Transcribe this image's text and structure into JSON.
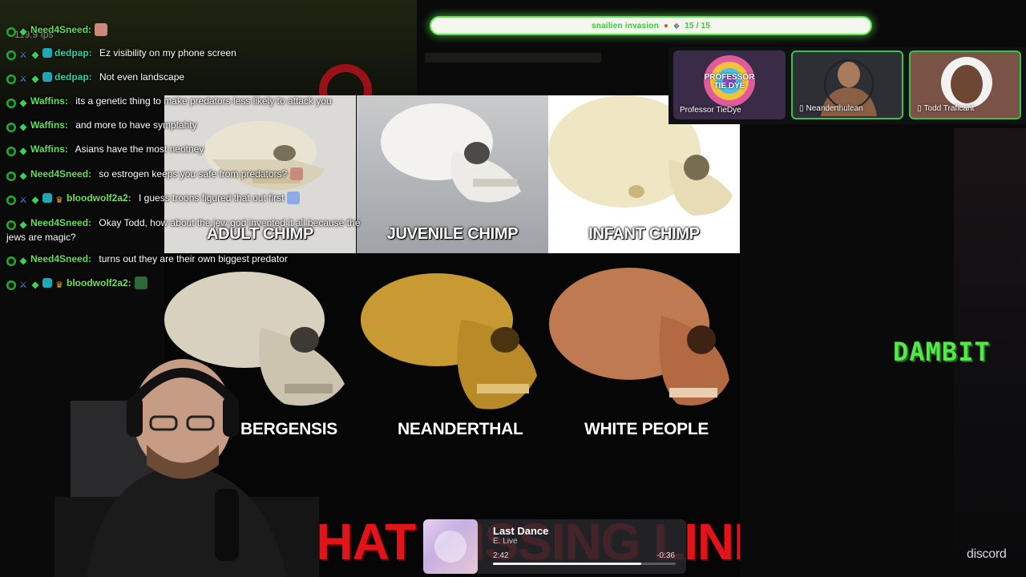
{
  "fps": "119.9 fps",
  "goal": {
    "label": "snailien invasion",
    "count": "15 / 15",
    "progress": 1.0
  },
  "chat": [
    {
      "user": "Need4Sneed:",
      "text": "",
      "badges": [
        "mod",
        "gem"
      ],
      "color": "#62e05a",
      "emote": true
    },
    {
      "user": "dedpap:",
      "text": "Ez visibility on my phone screen",
      "badges": [
        "mod",
        "sword",
        "gem",
        "grid"
      ],
      "color": "#2fd0a6"
    },
    {
      "user": "dedpap:",
      "text": "Not even landscape",
      "badges": [
        "mod",
        "sword",
        "gem",
        "grid"
      ],
      "color": "#2fd0a6"
    },
    {
      "user": "Waffins:",
      "text": "its a genetic thing to make predators less likely to attack you",
      "badges": [
        "mod",
        "gem"
      ],
      "color": "#62e05a"
    },
    {
      "user": "Waffins:",
      "text": "and more to have symptahty",
      "badges": [
        "mod",
        "gem"
      ],
      "color": "#62e05a"
    },
    {
      "user": "Waffins:",
      "text": "Asians have the most neotney",
      "badges": [
        "mod",
        "gem"
      ],
      "color": "#62e05a"
    },
    {
      "user": "Need4Sneed:",
      "text": "so estrogen keeps you safe from predators?",
      "badges": [
        "mod",
        "gem"
      ],
      "color": "#62e05a",
      "emote": true
    },
    {
      "user": "bloodwolf2a2:",
      "text": "I guess troons figured that out first",
      "badges": [
        "mod",
        "sword",
        "gem",
        "grid",
        "crown"
      ],
      "color": "#6fe35a",
      "emote": true
    },
    {
      "user": "Need4Sneed:",
      "text": "Okay Todd, how about the jew god invented it all because the jews are magic?",
      "badges": [
        "mod",
        "gem"
      ],
      "color": "#62e05a"
    },
    {
      "user": "Need4Sneed:",
      "text": "turns out they are their own biggest predator",
      "badges": [
        "mod",
        "gem"
      ],
      "color": "#62e05a"
    },
    {
      "user": "bloodwolf2a2:",
      "text": "",
      "badges": [
        "mod",
        "sword",
        "gem",
        "grid",
        "crown"
      ],
      "color": "#6fe35a",
      "emote": true
    }
  ],
  "meme": {
    "top_labels": [
      "ADULT CHIMP",
      "JUVENILE CHIMP",
      "INFANT CHIMP"
    ],
    "bottom_labels": [
      "BERGENSIS",
      "NEANDERTHAL",
      "WHITE PEOPLE"
    ],
    "bottom_title": "WHAT MISSING LINKS"
  },
  "discord": {
    "participants": [
      {
        "name": "Professor TieDye",
        "avatar_text": "PROFESSOR TIE DYE",
        "device_icon": false,
        "speaking": false
      },
      {
        "name": "Neanderthulean",
        "device_icon": true,
        "speaking": true
      },
      {
        "name": "Todd Traficant",
        "device_icon": true,
        "speaking": true
      }
    ],
    "logo": "discord"
  },
  "dambit": "DAMBIT",
  "player": {
    "title": "Last Dance",
    "artist": "E. Live",
    "elapsed": "2:42",
    "remaining": "-0:36",
    "progress": 0.81
  }
}
